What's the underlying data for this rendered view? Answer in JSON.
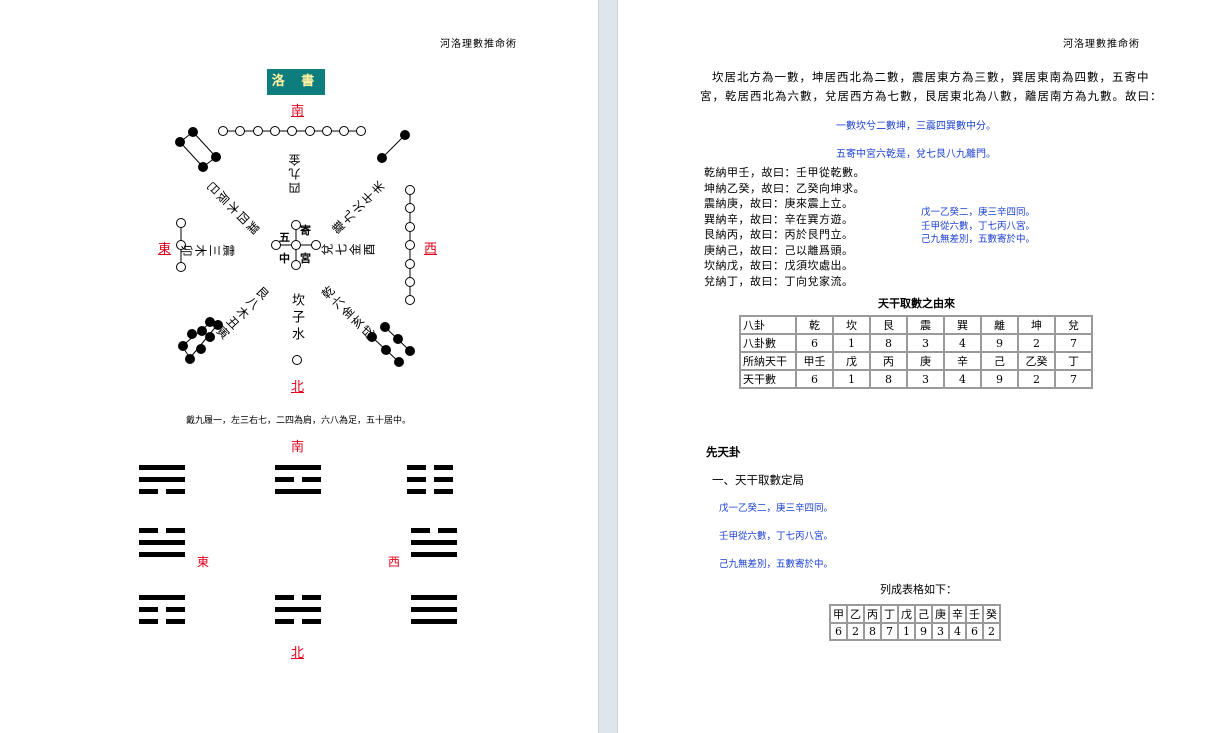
{
  "header": "河洛理數推命術",
  "left": {
    "title": "洛 書",
    "dirs": {
      "south": "南",
      "north": "北",
      "east": "東",
      "west": "西"
    },
    "labels": {
      "top": "四九金",
      "top_left": "巽四木辰巳",
      "top_right": "離九火午未",
      "left": "震三木卯",
      "right": "兌七金酉",
      "bottom_left": "艮八木丑寅",
      "bottom_right": "乾六金亥戌",
      "bottom": "坎子水",
      "center_top": "寄",
      "center_left": "五",
      "center_bottom_left": "中",
      "center_bottom_right": "宮"
    },
    "caption": "戴九履一，左三右七，二四為肩，六八為足，五十居中。",
    "trigram_dirs": {
      "south": "南",
      "north": "北",
      "east": "東",
      "west": "西"
    },
    "trigrams": [
      {
        "name": "trigram-top-left",
        "lines": [
          "solid",
          "solid",
          "broken"
        ]
      },
      {
        "name": "trigram-top-center",
        "lines": [
          "solid",
          "broken",
          "solid"
        ]
      },
      {
        "name": "trigram-top-right",
        "lines": [
          "broken",
          "broken",
          "broken"
        ]
      },
      {
        "name": "trigram-mid-left",
        "lines": [
          "broken",
          "solid",
          "solid"
        ]
      },
      {
        "name": "trigram-mid-right",
        "lines": [
          "broken",
          "solid",
          "solid"
        ]
      },
      {
        "name": "trigram-bottom-left",
        "lines": [
          "solid",
          "broken",
          "broken"
        ]
      },
      {
        "name": "trigram-bottom-center",
        "lines": [
          "broken",
          "solid",
          "broken"
        ]
      },
      {
        "name": "trigram-bottom-right",
        "lines": [
          "solid",
          "solid",
          "solid"
        ]
      }
    ]
  },
  "right": {
    "para1": "坎居北方為一數，坤居西北為二數，震居東方為三數，巽居東南為四數，五寄中",
    "para2": "宮，乾居西北為六數，兌居西方為七數，艮居東北為八數，離居南方為九數。故曰：",
    "verse1": "一數坎兮二數坤，三震四巽數中分。",
    "verse2": "五寄中宮六乾是，兌七艮八九離門。",
    "list": [
      "乾納甲壬，故曰：壬甲從乾數。",
      "坤納乙癸，故曰：乙癸向坤求。",
      "震納庚，故曰：庚來震上立。",
      "巽納辛，故曰：辛在巽方遊。",
      "艮納丙，故曰：丙於艮門立。",
      "庚納己，故曰：己以離爲頭。",
      "坎納戊，故曰：戊須坎處出。",
      "兌納丁，故曰：丁向兌家流。"
    ],
    "side_verse": [
      "戊一乙癸二，庚三辛四同。",
      "壬甲從六數，丁七丙八宮。",
      "己九無差別，五數寄於中。"
    ],
    "table1_title": "天干取數之由來",
    "table1": [
      [
        "八卦",
        "乾",
        "坎",
        "艮",
        "震",
        "巽",
        "離",
        "坤",
        "兌"
      ],
      [
        "八卦數",
        "6",
        "1",
        "8",
        "3",
        "4",
        "9",
        "2",
        "7"
      ],
      [
        "所納天干",
        "甲壬",
        "戊",
        "丙",
        "庚",
        "辛",
        "己",
        "乙癸",
        "丁"
      ],
      [
        "天干數",
        "6",
        "1",
        "8",
        "3",
        "4",
        "9",
        "2",
        "7"
      ]
    ],
    "section": "先天卦",
    "subsection": "一、天干取數定局",
    "blue_lines": [
      "戊一乙癸二，庚三辛四同。",
      "壬甲從六數，丁七丙八宮。",
      "己九無差別，五數寄於中。"
    ],
    "table2_title": "列成表格如下：",
    "table2": [
      [
        "甲",
        "乙",
        "丙",
        "丁",
        "戊",
        "己",
        "庚",
        "辛",
        "壬",
        "癸"
      ],
      [
        "6",
        "2",
        "8",
        "7",
        "1",
        "9",
        "3",
        "4",
        "6",
        "2"
      ]
    ]
  }
}
